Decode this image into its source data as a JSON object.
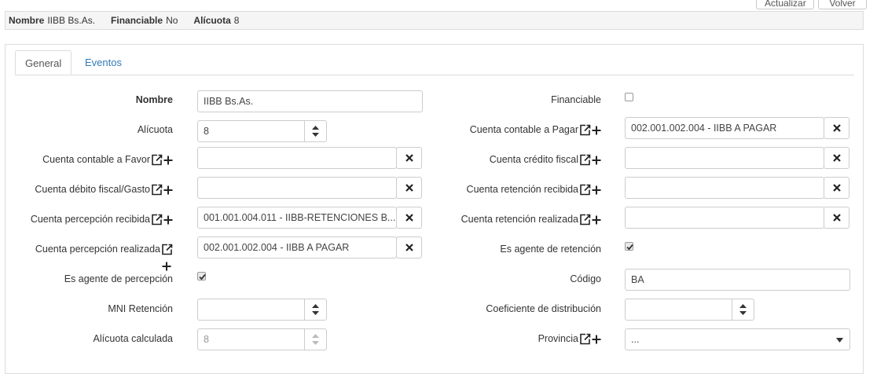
{
  "toolbar": {
    "update_label": "Actualizar",
    "back_label": "Volver"
  },
  "summary": [
    {
      "key": "Nombre",
      "value": "IIBB Bs.As."
    },
    {
      "key": "Financiable",
      "value": "No"
    },
    {
      "key": "Alícuota",
      "value": "8"
    }
  ],
  "tabs": [
    {
      "label": "General",
      "active": true
    },
    {
      "label": "Eventos",
      "active": false
    }
  ],
  "form": {
    "nombre": {
      "label": "Nombre",
      "value": "IIBB Bs.As."
    },
    "alicuota": {
      "label": "Alícuota",
      "value": "8"
    },
    "cuenta_favor": {
      "label": "Cuenta contable a Favor",
      "value": ""
    },
    "cuenta_debito": {
      "label": "Cuenta débito fiscal/Gasto",
      "value": ""
    },
    "cuenta_percepcion_recibida": {
      "label": "Cuenta percepción recibida",
      "value": "001.001.004.011 - IIBB-RETENCIONES B..."
    },
    "cuenta_percepcion_realizada": {
      "label": "Cuenta percepción realizada",
      "value": "002.001.002.004 - IIBB A PAGAR"
    },
    "agente_percepcion": {
      "label": "Es agente de percepción",
      "checked": true
    },
    "mni_retencion": {
      "label": "MNI Retención",
      "value": ""
    },
    "alicuota_calculada": {
      "label": "Alícuota calculada",
      "value": "8"
    },
    "financiable": {
      "label": "Financiable",
      "checked": false
    },
    "cuenta_pagar": {
      "label": "Cuenta contable a Pagar",
      "value": "002.001.002.004 - IIBB A PAGAR"
    },
    "cuenta_credito": {
      "label": "Cuenta crédito fiscal",
      "value": ""
    },
    "cuenta_retencion_recibida": {
      "label": "Cuenta retención recibida",
      "value": ""
    },
    "cuenta_retencion_realizada": {
      "label": "Cuenta retención realizada",
      "value": ""
    },
    "agente_retencion": {
      "label": "Es agente de retención",
      "checked": true
    },
    "codigo": {
      "label": "Código",
      "value": "BA"
    },
    "coeficiente": {
      "label": "Coeficiente de distribución",
      "value": ""
    },
    "provincia": {
      "label": "Provincia",
      "value": "..."
    }
  },
  "icons": {
    "open": "external-link-icon",
    "add": "plus-icon",
    "clear": "close-icon"
  },
  "colors": {
    "link": "#337ab7",
    "border": "#cccccc"
  }
}
